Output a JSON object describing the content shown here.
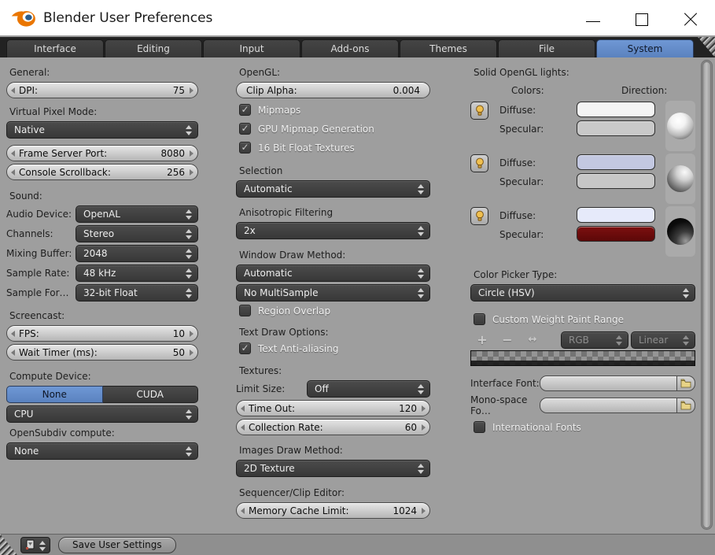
{
  "window": {
    "title": "Blender User Preferences"
  },
  "tabs": [
    {
      "label": "Interface",
      "active": false
    },
    {
      "label": "Editing",
      "active": false
    },
    {
      "label": "Input",
      "active": false
    },
    {
      "label": "Add-ons",
      "active": false
    },
    {
      "label": "Themes",
      "active": false
    },
    {
      "label": "File",
      "active": false
    },
    {
      "label": "System",
      "active": true
    }
  ],
  "icons": {
    "check": "✓",
    "plus": "+",
    "minus": "−",
    "flip": "↔"
  },
  "left": {
    "general_label": "General:",
    "dpi": {
      "label": "DPI:",
      "value": "75"
    },
    "virtual_pixel_label": "Virtual Pixel Mode:",
    "virtual_pixel_value": "Native",
    "frame_server_port": {
      "label": "Frame Server Port:",
      "value": "8080"
    },
    "console_scrollback": {
      "label": "Console Scrollback:",
      "value": "256"
    },
    "sound_label": "Sound:",
    "sound_rows": [
      {
        "label": "Audio Device:",
        "value": "OpenAL"
      },
      {
        "label": "Channels:",
        "value": "Stereo"
      },
      {
        "label": "Mixing Buffer:",
        "value": "2048"
      },
      {
        "label": "Sample Rate:",
        "value": "48 kHz"
      },
      {
        "label": "Sample For…",
        "value": "32-bit Float"
      }
    ],
    "screencast_label": "Screencast:",
    "fps": {
      "label": "FPS:",
      "value": "10"
    },
    "wait_timer": {
      "label": "Wait Timer (ms):",
      "value": "50"
    },
    "compute_device_label": "Compute Device:",
    "compute_none": "None",
    "compute_cuda": "CUDA",
    "compute_value": "CPU",
    "opensubdiv_label": "OpenSubdiv compute:",
    "opensubdiv_value": "None"
  },
  "middle": {
    "opengl_label": "OpenGL:",
    "clip_alpha": {
      "label": "Clip Alpha:",
      "value": "0.004"
    },
    "mipmaps_label": "Mipmaps",
    "gpu_mipmap_label": "GPU Mipmap Generation",
    "float_textures_label": "16 Bit Float Textures",
    "selection_label": "Selection",
    "selection_value": "Automatic",
    "anisotropic_label": "Anisotropic Filtering",
    "anisotropic_value": "2x",
    "window_draw_label": "Window Draw Method:",
    "window_draw_value": "Automatic",
    "multisample_value": "No MultiSample",
    "region_overlap_label": "Region Overlap",
    "text_draw_label": "Text Draw Options:",
    "text_antialiasing_label": "Text Anti-aliasing",
    "textures_label": "Textures:",
    "limit_size": {
      "label": "Limit Size:",
      "value": "Off"
    },
    "time_out": {
      "label": "Time Out:",
      "value": "120"
    },
    "collection_rate": {
      "label": "Collection Rate:",
      "value": "60"
    },
    "images_draw_label": "Images Draw Method:",
    "images_draw_value": "2D Texture",
    "sequencer_label": "Sequencer/Clip Editor:",
    "memory_cache": {
      "label": "Memory Cache Limit:",
      "value": "1024"
    }
  },
  "right": {
    "lights_label": "Solid OpenGL lights:",
    "colors_header": "Colors:",
    "direction_header": "Direction:",
    "lights": [
      {
        "diffuse_label": "Diffuse:",
        "specular_label": "Specular:",
        "diffuse_color": "#f4f4f4",
        "specular_color": "#c9c9c9"
      },
      {
        "diffuse_label": "Diffuse:",
        "specular_label": "Specular:",
        "diffuse_color": "#c3c8e1",
        "specular_color": "#c7c7c7"
      },
      {
        "diffuse_label": "Diffuse:",
        "specular_label": "Specular:",
        "diffuse_color": "#e6eafa",
        "specular_color": "#6d0c0c"
      }
    ],
    "color_picker_label": "Color Picker Type:",
    "color_picker_value": "Circle (HSV)",
    "weight_paint_label": "Custom Weight Paint Range",
    "colorband": {
      "interpolation": "RGB",
      "mode": "Linear"
    },
    "interface_font_label": "Interface Font:",
    "monospace_font_label": "Mono-space Fo…",
    "international_fonts_label": "International Fonts"
  },
  "footer": {
    "save_label": "Save User Settings"
  }
}
